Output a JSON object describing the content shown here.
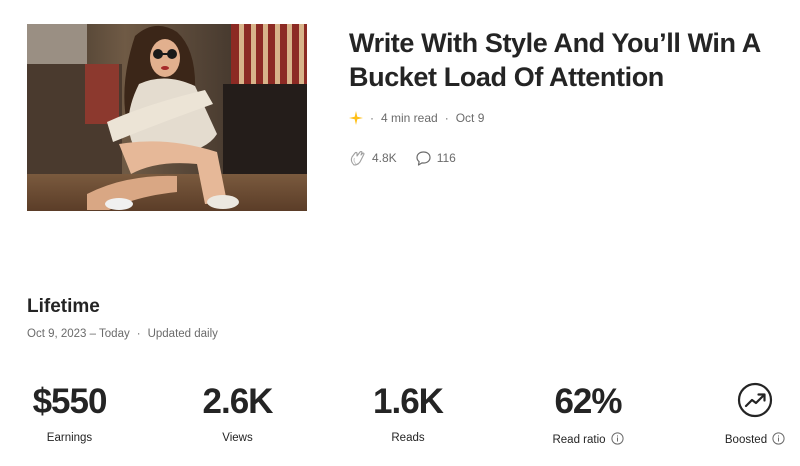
{
  "article": {
    "title": "Write With Style And You’ll Win A Bucket Load Of Attention",
    "image": "woman-sitting-on-floor-photo",
    "star_icon": "sparkle-star-icon",
    "star_color": "#FFC017",
    "read_time": "4 min read",
    "date": "Oct 9",
    "claps": "4.8K",
    "responses": "116"
  },
  "lifetime": {
    "heading": "Lifetime",
    "date_range": "Oct 9, 2023 – Today",
    "update_note": "Updated daily",
    "metrics": [
      {
        "value": "$550",
        "label": "Earnings"
      },
      {
        "value": "2.6K",
        "label": "Views"
      },
      {
        "value": "1.6K",
        "label": "Reads"
      },
      {
        "value": "62%",
        "label": "Read ratio"
      },
      {
        "label": "Boosted",
        "icon": "trending-up-circle-icon"
      }
    ]
  }
}
